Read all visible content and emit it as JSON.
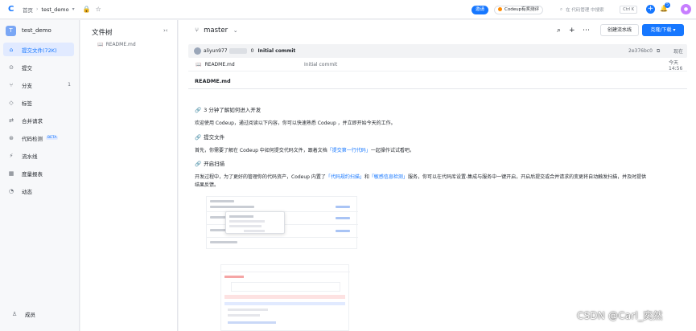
{
  "topbar": {
    "home_label": "首页",
    "repo_label": "test_demo",
    "invite_label": "邀请",
    "review_label": "Codeup有奖测评",
    "search_placeholder": "在 代码管理 中搜索",
    "shortcut": "Ctrl K",
    "notification_count": "5"
  },
  "sidebar": {
    "repo_initial": "T",
    "repo_name": "test_demo",
    "items": [
      {
        "label": "提交文件(72K)",
        "icon": "files-icon",
        "active": true
      },
      {
        "label": "提交",
        "icon": "commit-icon"
      },
      {
        "label": "分支",
        "icon": "branch-icon",
        "count": "1"
      },
      {
        "label": "标签",
        "icon": "tag-icon"
      },
      {
        "label": "合并请求",
        "icon": "merge-request-icon"
      },
      {
        "label": "代码检测",
        "icon": "code-scan-icon",
        "badge": "BETA"
      },
      {
        "label": "流水线",
        "icon": "pipeline-icon"
      },
      {
        "label": "度量报表",
        "icon": "report-icon"
      },
      {
        "label": "动态",
        "icon": "activity-icon"
      }
    ],
    "bottom_item": {
      "label": "成员",
      "icon": "members-icon"
    }
  },
  "filetree": {
    "title": "文件树",
    "files": [
      {
        "name": "README.md"
      }
    ]
  },
  "main": {
    "branch": "master",
    "create_pipeline": "创建流水线",
    "clone_download": "克隆/下载",
    "commit": {
      "author": "aliyun977",
      "count": "0",
      "message": "Initial commit",
      "hash": "2e376bc0",
      "time": "现在"
    },
    "file_row": {
      "name": "README.md",
      "message": "Initial commit",
      "time": "今天 14:56"
    },
    "readme_title": "README.md",
    "readme": {
      "h1": "3 分钟了解如何进入开发",
      "p1": "欢迎使用 Codeup，通过阅读以下内容，你可以快速熟悉 Codeup ，并立即开始今天的工作。",
      "h2": "提交文件",
      "p2_pre": "首先，你需要了解在 Codeup 中如何提交代码文件，跟着文档",
      "p2_link": "「提交第一行代码」",
      "p2_post": "一起操作试试看吧。",
      "h3": "开启扫描",
      "p3_pre": "开发过程中，为了更好的管理你的代码资产，Codeup 内置了",
      "p3_link1": "「代码规约扫描」",
      "p3_mid": "和",
      "p3_link2": "「敏感信息检测」",
      "p3_post": "服务，你可以在代码库设置-集成与服务中一键开启，开启后提交或合并请求的变更将自动触发扫描，并及时提供",
      "p3_line2": "结果反馈。"
    }
  },
  "watermark": "CSDN @Carl_奕然",
  "colors": {
    "accent": "#1677ff",
    "sidebar_bg": "#f7f8fa",
    "active_bg": "#e1eaff"
  }
}
